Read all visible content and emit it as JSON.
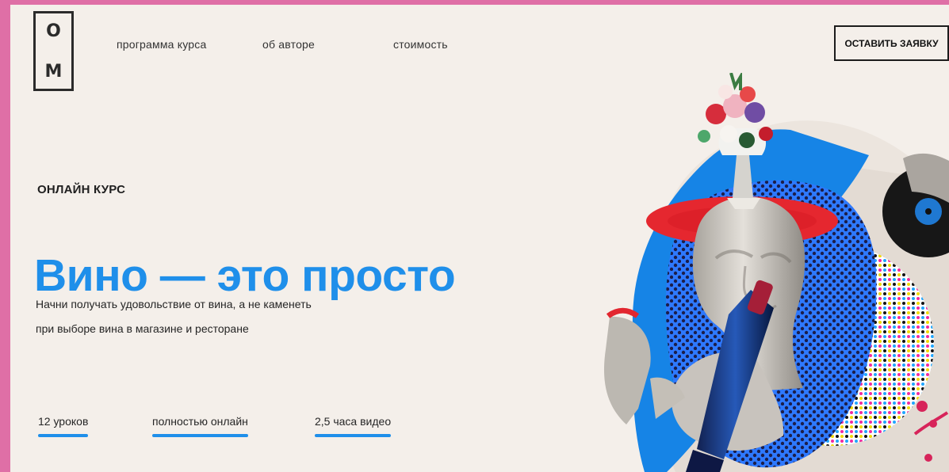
{
  "logo": {
    "top_letter": "О",
    "bottom_letter": "М"
  },
  "nav": {
    "program": "программа курса",
    "author": "об авторе",
    "price": "стоимость"
  },
  "cta": {
    "label": "ОСТАВИТЬ ЗАЯВКУ"
  },
  "hero": {
    "eyebrow": "ОНЛАЙН КУРС",
    "title": "Вино — это просто",
    "line1": "Начни получать удовольствие от вина, а не каменеть",
    "line2": "при выборе вина в магазине и ресторане"
  },
  "metrics": {
    "lessons": "12 уроков",
    "online": "полностью онлайн",
    "video": "2,5 часа видео"
  },
  "colors": {
    "accent": "#1f8fea",
    "frame": "#df6fa6",
    "background": "#f4efea",
    "record_red": "#e22f35"
  },
  "icons": {
    "collage": "wine-sculpture-collage-image"
  }
}
